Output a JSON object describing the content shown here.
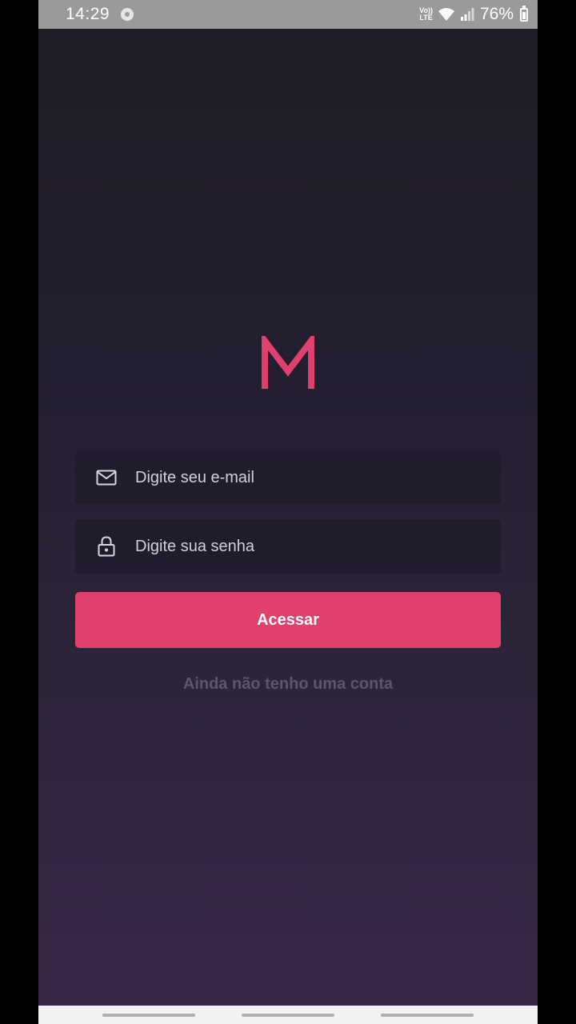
{
  "status_bar": {
    "time": "14:29",
    "volte_top": "Vo))",
    "volte_bottom": "LTE",
    "battery": "76%"
  },
  "app": {
    "logo_letter": "M",
    "accent_color": "#e0406c"
  },
  "login": {
    "email_placeholder": "Digite seu e-mail",
    "password_placeholder": "Digite sua senha",
    "submit_label": "Acessar",
    "signup_label": "Ainda não tenho uma conta"
  },
  "icons": {
    "email": "mail-icon",
    "password": "lock-icon"
  }
}
